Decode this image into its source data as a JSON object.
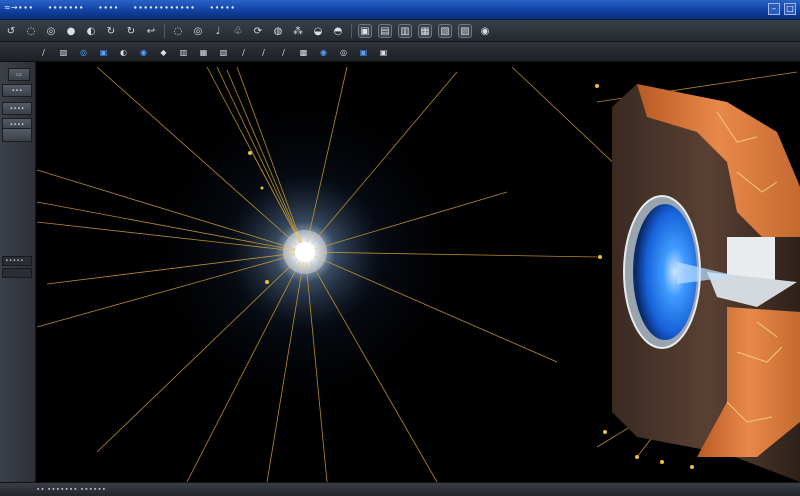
{
  "title_bar": {
    "menu": [
      "≈→∙∙∙",
      "∙∙∙∙∙∙∙",
      "∙∙∙∙",
      "∙∙∙∙∙∙∙∙∙∙∙∙",
      "∙∙∙∙∙"
    ],
    "window_buttons": [
      "–",
      "□"
    ]
  },
  "toolbar_primary": {
    "glyphs": [
      "↺",
      "◌",
      "◎",
      "●",
      "◐",
      "↻",
      "↻",
      "↩",
      "◌",
      "◎",
      "♩",
      "♧",
      "⟳",
      "◍",
      "⁂",
      "◒",
      "◓",
      "▣",
      "▤",
      "▥",
      "▦",
      "▧",
      "▨",
      "◉"
    ]
  },
  "toolbar_secondary": {
    "glyphs": [
      "∕",
      "▨",
      "◎",
      "▣",
      "◐",
      "◉",
      "◆",
      "▥",
      "▦",
      "▧",
      "∕",
      "∕",
      "∕",
      "▩",
      "◉",
      "◎",
      "▣",
      "▣"
    ]
  },
  "left_panel": {
    "button_1": "∙∙∙",
    "button_2": "∙∙∙∙",
    "button_3": "∙∙∙∙",
    "field": "∙∙∙∙∙"
  },
  "status_bar": {
    "text": "∙∙ ∙∙∙∙∙∙∙ ∙∙∙∙∙∙"
  },
  "scene": {
    "background": "#000000",
    "flare_color": "#ffffff",
    "ray_color": "#d9a52a",
    "ring_color": "#c76a2c",
    "disc_color": "#1e78ff"
  }
}
